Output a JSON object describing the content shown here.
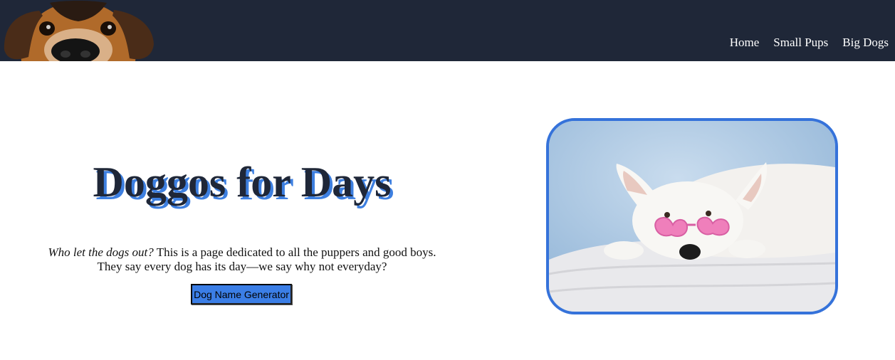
{
  "header": {
    "logo_icon": "dog-peeking-icon",
    "nav": [
      {
        "label": "Home"
      },
      {
        "label": "Small Pups"
      },
      {
        "label": "Big Dogs"
      }
    ]
  },
  "hero": {
    "title": "Doggos for Days",
    "tagline_em": "Who let the dogs out?",
    "tagline_line1_rest": " This is a page dedicated to all the puppers and good boys.",
    "tagline_line2": "They say every dog has its day—we say why not everyday?",
    "button_label": "Dog Name Generator",
    "photo_icon": "white-dog-with-heart-glasses-photo"
  },
  "colors": {
    "header_bg": "#1f2738",
    "accent": "#3b7ee6",
    "title_shadow": "#3d7fe0"
  }
}
